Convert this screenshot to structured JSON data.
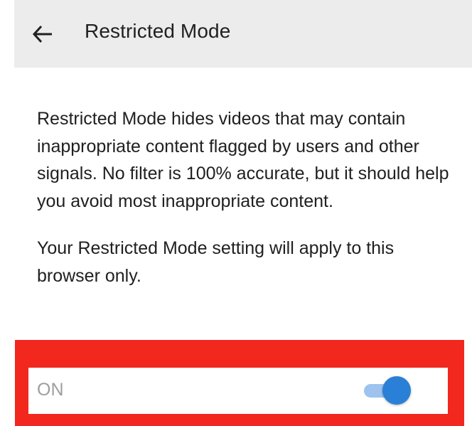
{
  "header": {
    "title": "Restricted Mode",
    "back_icon": "arrow-left-icon"
  },
  "description": {
    "paragraph_1": "Restricted Mode hides videos that may contain inappropriate content flagged by users and other signals. No filter is 100% accurate, but it should help you avoid most inappropriate content.",
    "paragraph_2": "Your Restricted Mode setting will apply to this browser only."
  },
  "toggle": {
    "label": "ON",
    "state": "on"
  },
  "colors": {
    "header_bg": "#ececec",
    "highlight": "#f2271e",
    "switch_thumb": "#2a7fd6",
    "switch_track": "#9dc3ee"
  }
}
